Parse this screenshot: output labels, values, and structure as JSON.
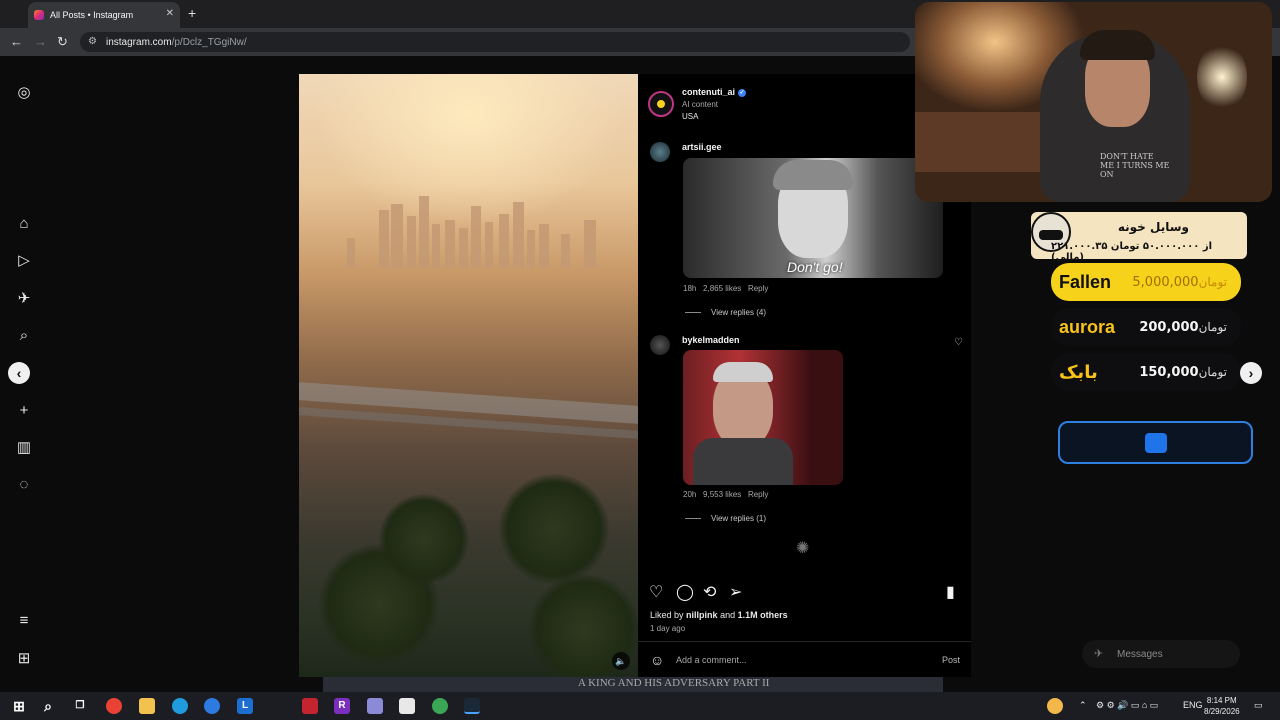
{
  "browser": {
    "tab_title": "All Posts • Instagram",
    "tab_close": "✕",
    "new_tab": "+",
    "url_host": "instagram.com",
    "url_path": "/p/Dclz_TGgiNw/"
  },
  "post": {
    "author": "contenuti_ai",
    "author_subtitle": "AI content",
    "location": "USA",
    "comments": [
      {
        "user": "artsii.gee",
        "caption": "Don't go!",
        "time": "18h",
        "likes": "2,865 likes",
        "reply": "Reply",
        "view_replies": "View replies (4)"
      },
      {
        "user": "bykelmadden",
        "time": "20h",
        "likes": "9,553 likes",
        "reply": "Reply",
        "view_replies": "View replies (1)"
      }
    ],
    "liked_by_prefix": "Liked by",
    "liked_by_user": "nillpink",
    "liked_by_and": "and",
    "liked_by_others": "1.1M others",
    "posted": "1 day ago",
    "add_comment_placeholder": "Add a comment...",
    "post_button": "Post"
  },
  "overlay": {
    "donate_title": "وسایل خونه",
    "donate_sub": "۲۲۱.۰۰۰.۳۵ از ۵۰.۰۰۰.۰۰۰ تومان (مالی)",
    "donors": [
      {
        "name": "Fallen",
        "amount": "5,000,000",
        "currency": "تومان",
        "bg": "#f7d21a",
        "fg": "#111111",
        "name_color": "#111111"
      },
      {
        "name": "aurora",
        "amount": "200,000",
        "currency": "تومان",
        "bg": "#0e0e10",
        "fg": "#ffffff",
        "name_color": "#f7c21a"
      },
      {
        "name": "بابک",
        "amount": "150,000",
        "currency": "تومان",
        "bg": "#0e0e10",
        "fg": "#ffffff",
        "name_color": "#f7c21a"
      }
    ],
    "webcam_shirt_text": "DON'T HATE ME I TURNS ME ON",
    "messages_label": "Messages"
  },
  "taskbar": {
    "lang": "ENG",
    "time": "8:14 PM",
    "date": "8/29/2026",
    "peek_title": "A KING AND HIS ADVERSARY PART II"
  },
  "colors": {
    "accent_blue": "#3b82f6",
    "donate_yellow": "#f7d21a"
  }
}
